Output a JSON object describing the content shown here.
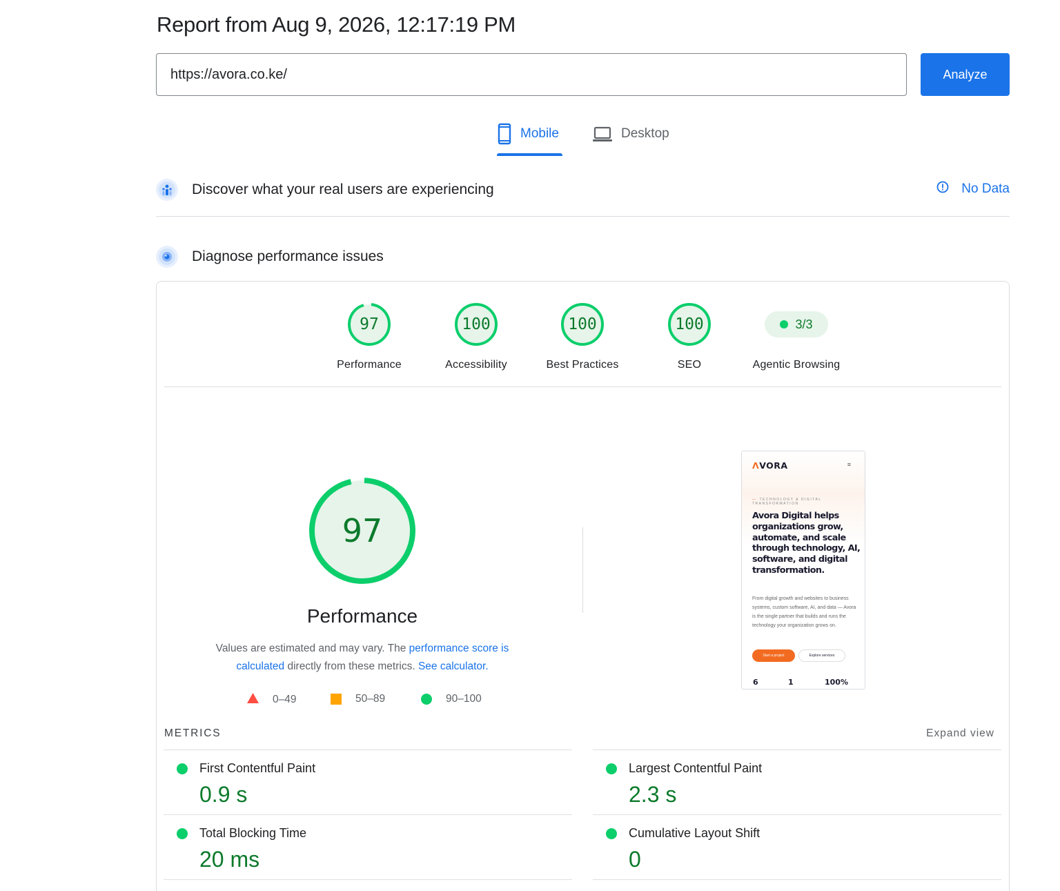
{
  "header": {
    "report_title": "Report from Aug 9, 2026, 12:17:19 PM"
  },
  "search": {
    "url_value": "https://avora.co.ke/",
    "analyze_label": "Analyze"
  },
  "tabs": [
    {
      "label": "Mobile",
      "icon": "phone-icon",
      "active": true
    },
    {
      "label": "Desktop",
      "icon": "laptop-icon",
      "active": false
    }
  ],
  "real_users": {
    "title": "Discover what your real users are experiencing",
    "status": "No Data"
  },
  "diagnose": {
    "title": "Diagnose performance issues"
  },
  "categories": [
    {
      "score": "97",
      "label": "Performance",
      "fraction": 0.97
    },
    {
      "score": "100",
      "label": "Accessibility",
      "fraction": 1.0
    },
    {
      "score": "100",
      "label": "Best Practices",
      "fraction": 1.0
    },
    {
      "score": "100",
      "label": "SEO",
      "fraction": 1.0
    },
    {
      "score": "3/3",
      "label": "Agentic Browsing"
    }
  ],
  "performance": {
    "score": "97",
    "fraction": 0.97,
    "title": "Performance",
    "desc_prefix": "Values are estimated and may vary. The ",
    "desc_link1": "performance score is calculated",
    "desc_middle": " directly from these metrics. ",
    "desc_link2": "See calculator."
  },
  "legend": [
    {
      "range": "0–49",
      "color": "#ff4e42"
    },
    {
      "range": "50–89",
      "color": "#ffa400"
    },
    {
      "range": "90–100",
      "color": "#0cce6b"
    }
  ],
  "screenshot": {
    "logo": "VORA",
    "logo_mark": "Λ",
    "menu": "≡",
    "eyebrow": "TECHNOLOGY & DIGITAL TRANSFORMATION",
    "headline": "Avora Digital helps organizations grow, automate, and scale through technology, AI, software, and digital transformation.",
    "body": "From digital growth and websites to business systems, custom software, AI, and data — Avora is the single partner that builds and runs the technology your organization grows on.",
    "btn_primary": "Start a project",
    "btn_secondary": "Explore services",
    "stats": [
      "6",
      "1",
      "100%"
    ]
  },
  "metrics": {
    "title": "METRICS",
    "expand": "Expand view",
    "items": [
      {
        "label": "First Contentful Paint",
        "value": "0.9 s"
      },
      {
        "label": "Largest Contentful Paint",
        "value": "2.3 s"
      },
      {
        "label": "Total Blocking Time",
        "value": "20 ms"
      },
      {
        "label": "Cumulative Layout Shift",
        "value": "0"
      }
    ]
  },
  "colors": {
    "accent": "#1a73e8",
    "pass": "#0cce6b",
    "pass_text": "#0c7a2b",
    "pass_bg": "#e6f4ea"
  }
}
